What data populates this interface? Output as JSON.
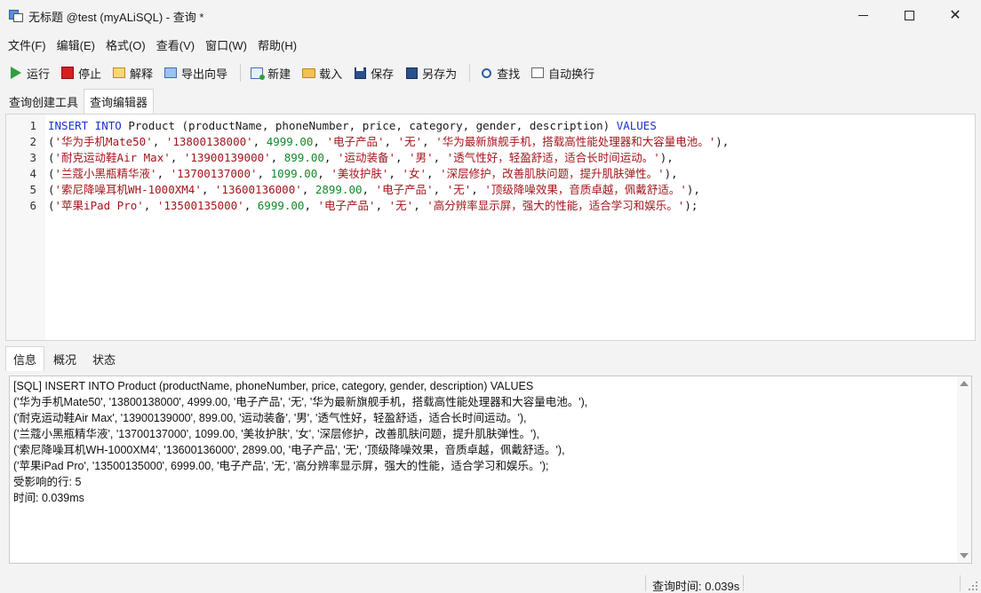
{
  "window": {
    "title": "无标题 @test (myALiSQL) - 查询 *"
  },
  "menu": [
    "文件(F)",
    "编辑(E)",
    "格式(O)",
    "查看(V)",
    "窗口(W)",
    "帮助(H)"
  ],
  "toolbar": {
    "run": "运行",
    "stop": "停止",
    "explain": "解释",
    "export": "导出向导",
    "new": "新建",
    "load": "载入",
    "save": "保存",
    "save_as": "另存为",
    "find": "查找",
    "wrap": "自动换行"
  },
  "editor_tabs": [
    "查询创建工具",
    "查询编辑器"
  ],
  "editor": {
    "lines": [
      {
        "n": "1",
        "tokens": [
          [
            "kw",
            "INSERT INTO"
          ],
          [
            "pl",
            " Product (productName, phoneNumber, price, category, gender, description) "
          ],
          [
            "kw",
            "VALUES"
          ]
        ]
      },
      {
        "n": "2",
        "tokens": [
          [
            "pl",
            "("
          ],
          [
            "str",
            "'华为手机Mate50'"
          ],
          [
            "pl",
            ", "
          ],
          [
            "str",
            "'13800138000'"
          ],
          [
            "pl",
            ", "
          ],
          [
            "num",
            "4999.00"
          ],
          [
            "pl",
            ", "
          ],
          [
            "str",
            "'电子产品'"
          ],
          [
            "pl",
            ", "
          ],
          [
            "str",
            "'无'"
          ],
          [
            "pl",
            ", "
          ],
          [
            "str",
            "'华为最新旗舰手机，搭载高性能处理器和大容量电池。'"
          ],
          [
            "pl",
            "),"
          ]
        ]
      },
      {
        "n": "3",
        "tokens": [
          [
            "pl",
            "("
          ],
          [
            "str",
            "'耐克运动鞋Air Max'"
          ],
          [
            "pl",
            ", "
          ],
          [
            "str",
            "'13900139000'"
          ],
          [
            "pl",
            ", "
          ],
          [
            "num",
            "899.00"
          ],
          [
            "pl",
            ", "
          ],
          [
            "str",
            "'运动装备'"
          ],
          [
            "pl",
            ", "
          ],
          [
            "str",
            "'男'"
          ],
          [
            "pl",
            ", "
          ],
          [
            "str",
            "'透气性好，轻盈舒适，适合长时间运动。'"
          ],
          [
            "pl",
            "),"
          ]
        ]
      },
      {
        "n": "4",
        "tokens": [
          [
            "pl",
            "("
          ],
          [
            "str",
            "'兰蔻小黑瓶精华液'"
          ],
          [
            "pl",
            ", "
          ],
          [
            "str",
            "'13700137000'"
          ],
          [
            "pl",
            ", "
          ],
          [
            "num",
            "1099.00"
          ],
          [
            "pl",
            ", "
          ],
          [
            "str",
            "'美妆护肤'"
          ],
          [
            "pl",
            ", "
          ],
          [
            "str",
            "'女'"
          ],
          [
            "pl",
            ", "
          ],
          [
            "str",
            "'深层修护，改善肌肤问题，提升肌肤弹性。'"
          ],
          [
            "pl",
            "),"
          ]
        ]
      },
      {
        "n": "5",
        "tokens": [
          [
            "pl",
            "("
          ],
          [
            "str",
            "'索尼降噪耳机WH-1000XM4'"
          ],
          [
            "pl",
            ", "
          ],
          [
            "str",
            "'13600136000'"
          ],
          [
            "pl",
            ", "
          ],
          [
            "num",
            "2899.00"
          ],
          [
            "pl",
            ", "
          ],
          [
            "str",
            "'电子产品'"
          ],
          [
            "pl",
            ", "
          ],
          [
            "str",
            "'无'"
          ],
          [
            "pl",
            ", "
          ],
          [
            "str",
            "'顶级降噪效果，音质卓越，佩戴舒适。'"
          ],
          [
            "pl",
            "),"
          ]
        ]
      },
      {
        "n": "6",
        "tokens": [
          [
            "pl",
            "("
          ],
          [
            "str",
            "'苹果iPad Pro'"
          ],
          [
            "pl",
            ", "
          ],
          [
            "str",
            "'13500135000'"
          ],
          [
            "pl",
            ", "
          ],
          [
            "num",
            "6999.00"
          ],
          [
            "pl",
            ", "
          ],
          [
            "str",
            "'电子产品'"
          ],
          [
            "pl",
            ", "
          ],
          [
            "str",
            "'无'"
          ],
          [
            "pl",
            ", "
          ],
          [
            "str",
            "'高分辨率显示屏，强大的性能，适合学习和娱乐。'"
          ],
          [
            "pl",
            ");"
          ]
        ]
      }
    ]
  },
  "result_tabs": [
    "信息",
    "概况",
    "状态"
  ],
  "info": {
    "lines": [
      "[SQL] INSERT INTO Product (productName, phoneNumber, price, category, gender, description) VALUES",
      "('华为手机Mate50', '13800138000', 4999.00, '电子产品', '无', '华为最新旗舰手机，搭载高性能处理器和大容量电池。'),",
      "('耐克运动鞋Air Max', '13900139000', 899.00, '运动装备', '男', '透气性好，轻盈舒适，适合长时间运动。'),",
      "('兰蔻小黑瓶精华液', '13700137000', 1099.00, '美妆护肤', '女', '深层修护，改善肌肤问题，提升肌肤弹性。'),",
      "('索尼降噪耳机WH-1000XM4', '13600136000', 2899.00, '电子产品', '无', '顶级降噪效果，音质卓越，佩戴舒适。'),",
      "('苹果iPad Pro', '13500135000', 6999.00, '电子产品', '无', '高分辨率显示屏，强大的性能，适合学习和娱乐。');",
      "受影响的行: 5",
      "时间: 0.039ms"
    ]
  },
  "status": {
    "query_time": "查询时间: 0.039s"
  },
  "colors": {
    "keyword": "#1c31d8",
    "string": "#a3151c",
    "number": "#15872a"
  }
}
